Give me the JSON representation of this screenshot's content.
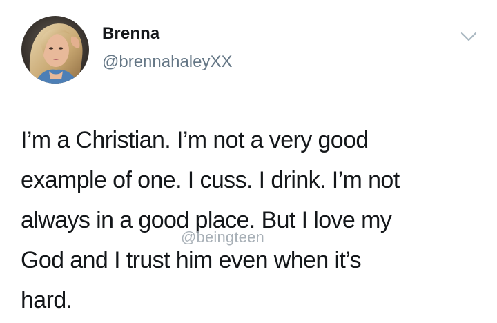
{
  "author": {
    "name": "Brenna",
    "handle": "@brennahaleyXX",
    "avatar_icon": "profile-photo"
  },
  "tweet": {
    "lines": [
      "I’m a Christian. I’m not a very good",
      "example of one. I cuss. I drink. I’m not",
      "always in a good place. But I love my",
      "God and I trust him even when it’s",
      "hard."
    ]
  },
  "watermark": "@beingteen",
  "menu": {
    "icon": "chevron-down-icon"
  },
  "colors": {
    "text": "#14171a",
    "secondary": "#657786",
    "watermark": "#9aa3ab",
    "background": "#ffffff"
  }
}
